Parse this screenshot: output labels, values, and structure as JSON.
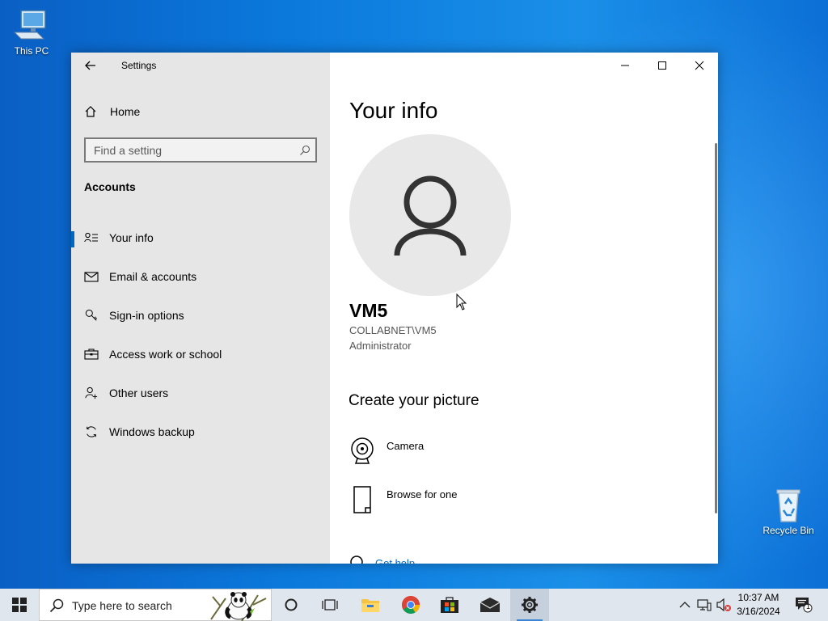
{
  "desktop": {
    "icons": [
      {
        "label": "This PC",
        "icon": "computer-icon"
      },
      {
        "label": "Recycle Bin",
        "icon": "recycle-bin-icon"
      }
    ]
  },
  "window": {
    "title": "Settings",
    "sidebar": {
      "home_label": "Home",
      "search_placeholder": "Find a setting",
      "section": "Accounts",
      "items": [
        {
          "label": "Your info",
          "icon": "person-card-icon",
          "active": true
        },
        {
          "label": "Email & accounts",
          "icon": "mail-icon"
        },
        {
          "label": "Sign-in options",
          "icon": "key-icon"
        },
        {
          "label": "Access work or school",
          "icon": "briefcase-icon"
        },
        {
          "label": "Other users",
          "icon": "add-person-icon"
        },
        {
          "label": "Windows backup",
          "icon": "sync-icon"
        }
      ]
    },
    "content": {
      "title": "Your info",
      "user": {
        "name": "VM5",
        "domain": "COLLABNET\\VM5",
        "role": "Administrator"
      },
      "create_picture": {
        "heading": "Create your picture",
        "options": [
          {
            "label": "Camera",
            "icon": "camera-icon"
          },
          {
            "label": "Browse for one",
            "icon": "file-icon"
          }
        ]
      },
      "help_link": "Get help"
    }
  },
  "taskbar": {
    "search_placeholder": "Type here to search",
    "clock": {
      "time": "10:37 AM",
      "date": "3/16/2024"
    },
    "notification_count": "1"
  },
  "colors": {
    "accent": "#0067c0",
    "sidebar_bg": "#e6e6e6",
    "taskbar_bg": "#dfe6ee"
  }
}
